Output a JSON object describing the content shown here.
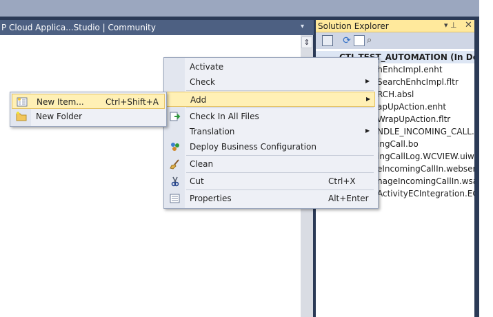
{
  "document": {
    "title": "P Cloud Applica...Studio | Community",
    "dropdown_glyph": "▾"
  },
  "solution_explorer": {
    "title": "Solution Explorer",
    "pin": "▾ ⊥",
    "close": "✕",
    "root": "CTI_TEST_AUTOMATION (In Develo",
    "items": [
      "rchEnhcImpl.enht",
      "SearchEnhcImpl.fltr",
      "RCH.absl",
      "apUpAction.enht",
      "WrapUpAction.fltr",
      "NDLE_INCOMING_CALL.ab",
      "ingCall.bo",
      "ingCallLog.WCVIEW.uiwocv",
      "eIncomingCallIn.webservic",
      "nageIncomingCallIn.wsaut",
      "ActivityECIntegration.EC.u"
    ]
  },
  "context_menu": {
    "items": [
      {
        "label": "Activate",
        "shortcut": "",
        "submenu": false,
        "icon": ""
      },
      {
        "label": "Check",
        "shortcut": "",
        "submenu": true,
        "icon": ""
      },
      {
        "label": "Add",
        "shortcut": "",
        "submenu": true,
        "icon": "",
        "highlighted": true
      },
      {
        "label": "Check In All Files",
        "shortcut": "",
        "submenu": false,
        "icon": "check-in-icon"
      },
      {
        "label": "Translation",
        "shortcut": "",
        "submenu": true,
        "icon": ""
      },
      {
        "label": "Deploy Business Configuration",
        "shortcut": "",
        "submenu": false,
        "icon": "deploy-icon"
      },
      {
        "label": "Clean",
        "shortcut": "",
        "submenu": false,
        "icon": "broom-icon"
      },
      {
        "label": "Cut",
        "shortcut": "Ctrl+X",
        "submenu": false,
        "icon": "scissors-icon"
      },
      {
        "label": "Properties",
        "shortcut": "Alt+Enter",
        "submenu": false,
        "icon": "properties-icon"
      }
    ],
    "arrow": "▶"
  },
  "add_submenu": {
    "items": [
      {
        "label": "New Item...",
        "shortcut": "Ctrl+Shift+A",
        "icon": "new-item-icon",
        "highlighted": true
      },
      {
        "label": "New Folder",
        "shortcut": "",
        "icon": "new-folder-icon"
      }
    ]
  },
  "colors": {
    "accent_highlight": "#fff0b5",
    "chrome_dark": "#2b3a56",
    "panel_header": "#ffe99c"
  }
}
